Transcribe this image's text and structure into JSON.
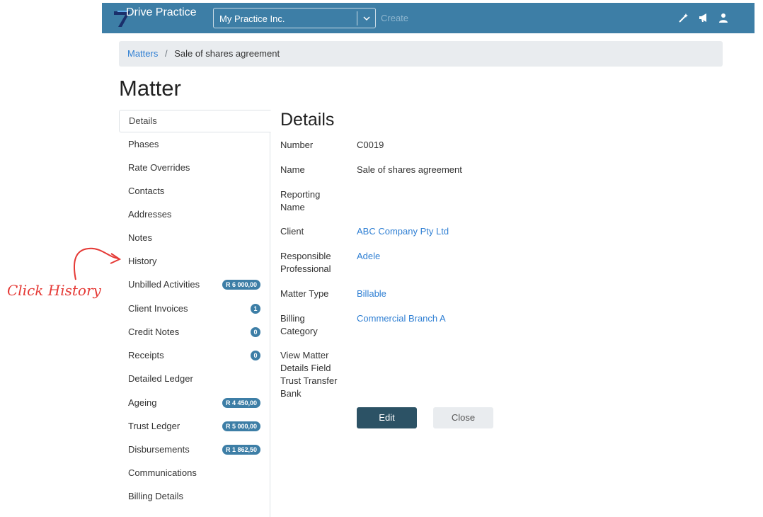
{
  "topbar": {
    "brand_name": "Drive Practice",
    "practice_select": "My Practice Inc.",
    "create_label": "Create",
    "icons": [
      "magic-wand-icon",
      "megaphone-icon",
      "user-icon"
    ],
    "bg_color": "#3d7ea6"
  },
  "breadcrumb": {
    "parent": "Matters",
    "separator": "/",
    "current": "Sale of shares agreement"
  },
  "page_title": "Matter",
  "sidenav": {
    "items": [
      {
        "label": "Details",
        "active": true
      },
      {
        "label": "Phases"
      },
      {
        "label": "Rate Overrides"
      },
      {
        "label": "Contacts"
      },
      {
        "label": "Addresses"
      },
      {
        "label": "Notes"
      },
      {
        "label": "History"
      },
      {
        "label": "Unbilled Activities",
        "badge": "R 6 000,00"
      },
      {
        "label": "Client Invoices",
        "badge": "1"
      },
      {
        "label": "Credit Notes",
        "badge": "0"
      },
      {
        "label": "Receipts",
        "badge": "0"
      },
      {
        "label": "Detailed Ledger"
      },
      {
        "label": "Ageing",
        "badge": "R 4 450,00"
      },
      {
        "label": "Trust Ledger",
        "badge": "R 5 000,00"
      },
      {
        "label": "Disbursements",
        "badge": "R 1 862,50"
      },
      {
        "label": "Communications"
      },
      {
        "label": "Billing Details"
      }
    ]
  },
  "annotation": {
    "text": "Click History",
    "color": "#e53935"
  },
  "details": {
    "title": "Details",
    "fields": [
      {
        "label": "Number",
        "value": "C0019"
      },
      {
        "label": "Name",
        "value": "Sale of shares agreement"
      },
      {
        "label": "Reporting Name",
        "value": ""
      },
      {
        "label": "Client",
        "value": "ABC Company Pty Ltd"
      },
      {
        "label": "Responsible Professional",
        "value": "Adele"
      },
      {
        "label": "Matter Type",
        "value": "Billable"
      },
      {
        "label": "Billing Category",
        "value": "Commercial Branch A"
      },
      {
        "label": "View Matter Details Field Trust Transfer Bank",
        "value": ""
      }
    ],
    "edit_label": "Edit",
    "close_label": "Close"
  }
}
